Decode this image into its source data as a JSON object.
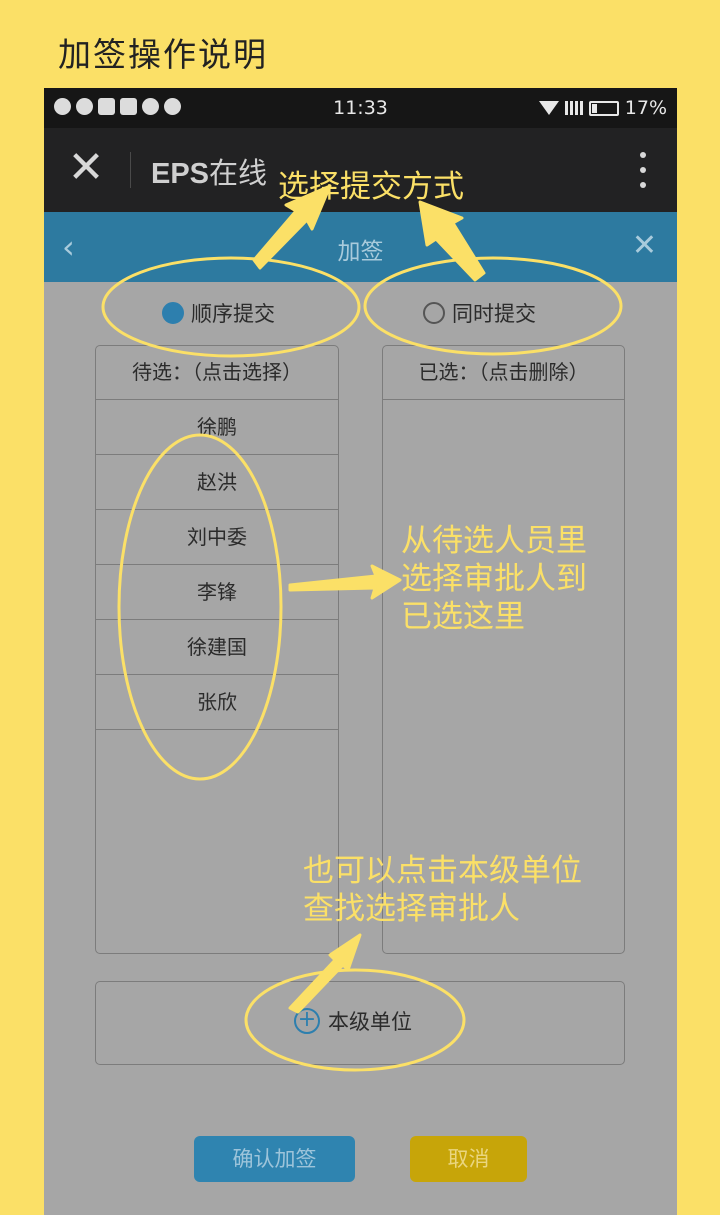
{
  "page_title": "加签操作说明",
  "statusbar": {
    "time": "11:33",
    "battery": "17%"
  },
  "appbar": {
    "title_latin": "EPS",
    "title_cn": "在线"
  },
  "subbar": {
    "title": "加签",
    "back_icon": "chevron-left-icon",
    "close_icon": "close-icon"
  },
  "options": {
    "sequential": "顺序提交",
    "simultaneous": "同时提交",
    "selected": "sequential"
  },
  "candidates": {
    "header": "待选：（点击选择）",
    "items": [
      "徐鹏",
      "赵洪",
      "刘中委",
      "李锋",
      "徐建国",
      "张欣"
    ]
  },
  "chosen": {
    "header": "已选：（点击删除）",
    "items": []
  },
  "unit_button": "本级单位",
  "buttons": {
    "confirm": "确认加签",
    "cancel": "取消"
  },
  "annotations": {
    "submit_mode": "选择提交方式",
    "pick": [
      "从待选人员里",
      "选择审批人到",
      "已选这里"
    ],
    "unit": [
      "也可以点击本级单位",
      "查找选择审批人"
    ]
  },
  "colors": {
    "background": "#fbe067",
    "accent": "#2d7aa0",
    "cancel": "#c7a509",
    "annotation": "#fbe067"
  }
}
